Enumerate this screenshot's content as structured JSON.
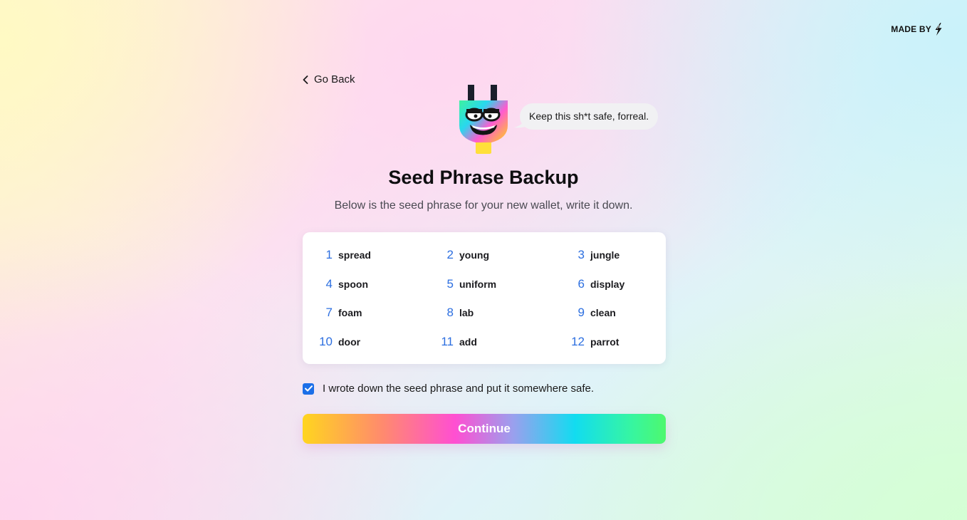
{
  "header": {
    "made_by_label": "MADE BY",
    "made_by_icon": "lightning-bolt-icon"
  },
  "nav": {
    "back_label": "Go Back",
    "back_icon": "chevron-left-icon"
  },
  "mascot": {
    "icon": "plug-mascot-icon",
    "speech": "Keep this sh*t safe, forreal."
  },
  "page": {
    "title": "Seed Phrase Backup",
    "subtitle": "Below is the seed phrase for your new wallet, write it down."
  },
  "seed_phrase": {
    "words": [
      {
        "index": "1",
        "word": "spread"
      },
      {
        "index": "2",
        "word": "young"
      },
      {
        "index": "3",
        "word": "jungle"
      },
      {
        "index": "4",
        "word": "spoon"
      },
      {
        "index": "5",
        "word": "uniform"
      },
      {
        "index": "6",
        "word": "display"
      },
      {
        "index": "7",
        "word": "foam"
      },
      {
        "index": "8",
        "word": "lab"
      },
      {
        "index": "9",
        "word": "clean"
      },
      {
        "index": "10",
        "word": "door"
      },
      {
        "index": "11",
        "word": "add"
      },
      {
        "index": "12",
        "word": "parrot"
      }
    ]
  },
  "confirmation": {
    "checked": true,
    "label": "I wrote down the seed phrase and put it somewhere safe."
  },
  "actions": {
    "continue_label": "Continue"
  },
  "colors": {
    "accent_blue": "#2d6fe0",
    "checkbox_blue": "#1c6fe8",
    "button_gradient": [
      "#ffd51f",
      "#ff4fd2",
      "#12dcf0",
      "#4ef86e"
    ]
  }
}
